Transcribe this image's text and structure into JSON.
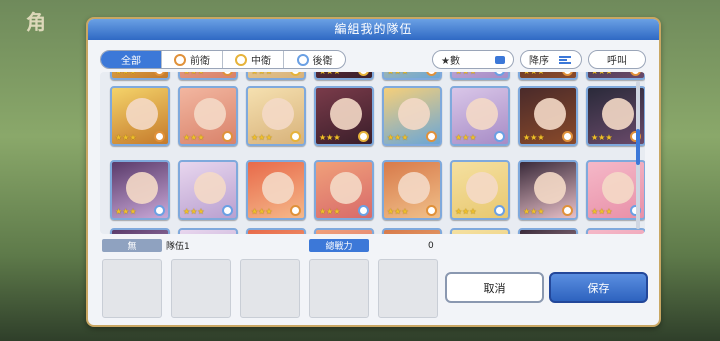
{
  "background": {
    "logo_text": "角"
  },
  "dialog": {
    "title": "編組我的隊伍"
  },
  "filter_tabs": [
    {
      "label": "全部",
      "active": true,
      "icon": ""
    },
    {
      "label": "前衛",
      "active": false,
      "icon": "front-role-icon"
    },
    {
      "label": "中衛",
      "active": false,
      "icon": "middle-role-icon"
    },
    {
      "label": "後衛",
      "active": false,
      "icon": "back-role-icon"
    }
  ],
  "sort": {
    "key_label": "★數",
    "order_label": "降序",
    "call_label": "呼叫"
  },
  "grid": {
    "rows": [
      {
        "cards": [
          {
            "stars": "★★★",
            "role": "front",
            "colors": [
              "#f4d36a",
              "#c57a2b"
            ]
          },
          {
            "stars": "★★★",
            "role": "front",
            "colors": [
              "#f2b6a0",
              "#d9826a"
            ]
          },
          {
            "stars": "★★★",
            "role": "middle",
            "colors": [
              "#f5e0b0",
              "#d8b27a"
            ]
          },
          {
            "stars": "★★★",
            "role": "middle",
            "colors": [
              "#7a3b4a",
              "#3a1e2a"
            ]
          },
          {
            "stars": "★★★",
            "role": "front",
            "colors": [
              "#f5cf7a",
              "#6aa6d6"
            ]
          },
          {
            "stars": "★★★",
            "role": "back",
            "colors": [
              "#d9c6e8",
              "#a78cc6"
            ]
          },
          {
            "stars": "★★★",
            "role": "front",
            "colors": [
              "#4a2a2a",
              "#8a4a2a"
            ]
          },
          {
            "stars": "★★★",
            "role": "front",
            "colors": [
              "#2a2a3a",
              "#6a4a6a"
            ]
          }
        ]
      },
      {
        "cards": [
          {
            "stars": "★★★",
            "role": "back",
            "colors": [
              "#5a3a6a",
              "#c9a8d8"
            ]
          },
          {
            "stars": "★★★",
            "role": "back",
            "colors": [
              "#e8d6ee",
              "#b9a0d0"
            ]
          },
          {
            "stars": "★★★",
            "role": "front",
            "colors": [
              "#e86a4a",
              "#f5b88a"
            ]
          },
          {
            "stars": "★★★",
            "role": "back",
            "colors": [
              "#f0a07a",
              "#d86a6a"
            ]
          },
          {
            "stars": "★★★",
            "role": "front",
            "colors": [
              "#d87a4a",
              "#f0c08a"
            ]
          },
          {
            "stars": "★★★",
            "role": "back",
            "colors": [
              "#f5e0a0",
              "#e8c870"
            ]
          },
          {
            "stars": "★★★",
            "role": "front",
            "colors": [
              "#3a2a3a",
              "#e8c0c8"
            ]
          },
          {
            "stars": "★★★",
            "role": "back",
            "colors": [
              "#f5b8c8",
              "#e890a8"
            ]
          }
        ]
      }
    ]
  },
  "team": {
    "tag": "無",
    "name": "隊伍1",
    "power_label": "總戰力",
    "power_value": "0"
  },
  "buttons": {
    "cancel": "取消",
    "save": "保存"
  }
}
